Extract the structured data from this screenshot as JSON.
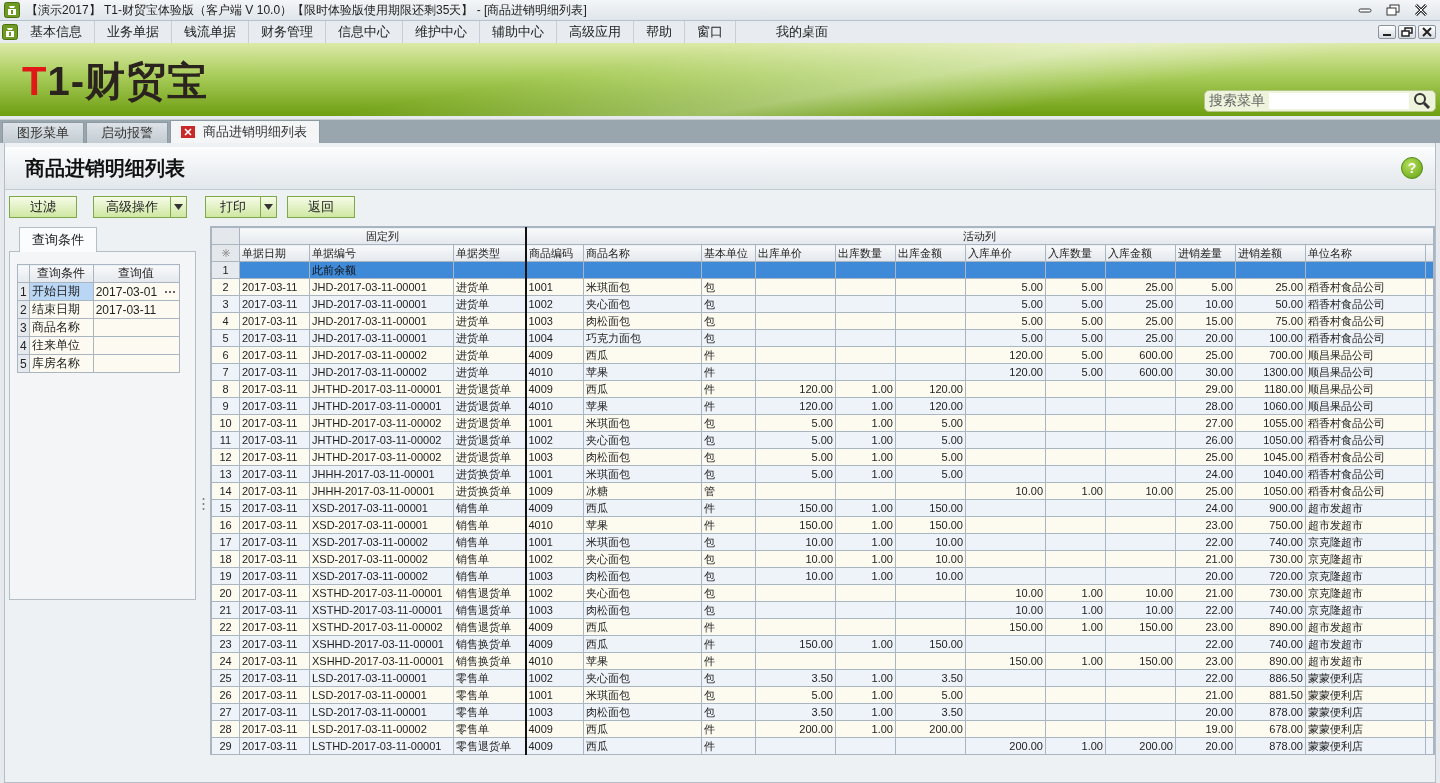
{
  "window": {
    "title": "【演示2017】 T1-财贸宝体验版（客户端 V 10.0）【限时体验版使用期限还剩35天】 - [商品进销明细列表]"
  },
  "menu": {
    "items": [
      "基本信息",
      "业务单据",
      "钱流单据",
      "财务管理",
      "信息中心",
      "维护中心",
      "辅助中心",
      "高级应用",
      "帮助",
      "窗口",
      "我的桌面"
    ]
  },
  "banner": {
    "logo": "T1-财贸宝",
    "search": {
      "label": "搜索菜单"
    }
  },
  "tabs": [
    {
      "label": "图形菜单",
      "selected": false,
      "closable": false
    },
    {
      "label": "启动报警",
      "selected": false,
      "closable": false
    },
    {
      "label": "商品进销明细列表",
      "selected": true,
      "closable": true
    }
  ],
  "page": {
    "title": "商品进销明细列表",
    "help": "?"
  },
  "toolbar": [
    {
      "label": "过滤",
      "kind": "plain"
    },
    {
      "label": "高级操作",
      "kind": "split"
    },
    {
      "label": "打印",
      "kind": "split"
    },
    {
      "label": "返回",
      "kind": "plain"
    }
  ],
  "query": {
    "tab": "查询条件",
    "columns": [
      "查询条件",
      "查询值"
    ],
    "rows": [
      {
        "no": "1",
        "name": "开始日期",
        "value": "2017-03-01",
        "selected": true
      },
      {
        "no": "2",
        "name": "结束日期",
        "value": "2017-03-11",
        "selected": false
      },
      {
        "no": "3",
        "name": "商品名称",
        "selected": false
      },
      {
        "no": "4",
        "name": "往来单位",
        "selected": false
      },
      {
        "no": "5",
        "name": "库房名称",
        "selected": false
      }
    ]
  },
  "table": {
    "groups": [
      "固定列",
      "活动列"
    ],
    "columns": [
      "单据日期",
      "单据编号",
      "单据类型",
      "商品编码",
      "商品名称",
      "基本单位",
      "出库单价",
      "出库数量",
      "出库金额",
      "入库单价",
      "入库数量",
      "入库金额",
      "进销差量",
      "进销差额",
      "单位名称"
    ],
    "rows": [
      {
        "no": "1",
        "selected": true,
        "cells": [
          "",
          "此前余额",
          "",
          "",
          "",
          "",
          "",
          "",
          "",
          "",
          "",
          "",
          "",
          "",
          ""
        ]
      },
      {
        "no": "2",
        "selected": false,
        "cells": [
          "2017-03-11",
          "JHD-2017-03-11-00001",
          "进货单",
          "1001",
          "米琪面包",
          "包",
          "",
          "",
          "",
          "5.00",
          "5.00",
          "25.00",
          "5.00",
          "25.00",
          "稻香村食品公司"
        ]
      },
      {
        "no": "3",
        "selected": false,
        "cells": [
          "2017-03-11",
          "JHD-2017-03-11-00001",
          "进货单",
          "1002",
          "夹心面包",
          "包",
          "",
          "",
          "",
          "5.00",
          "5.00",
          "25.00",
          "10.00",
          "50.00",
          "稻香村食品公司"
        ]
      },
      {
        "no": "4",
        "selected": false,
        "cells": [
          "2017-03-11",
          "JHD-2017-03-11-00001",
          "进货单",
          "1003",
          "肉松面包",
          "包",
          "",
          "",
          "",
          "5.00",
          "5.00",
          "25.00",
          "15.00",
          "75.00",
          "稻香村食品公司"
        ]
      },
      {
        "no": "5",
        "selected": false,
        "cells": [
          "2017-03-11",
          "JHD-2017-03-11-00001",
          "进货单",
          "1004",
          "巧克力面包",
          "包",
          "",
          "",
          "",
          "5.00",
          "5.00",
          "25.00",
          "20.00",
          "100.00",
          "稻香村食品公司"
        ]
      },
      {
        "no": "6",
        "selected": false,
        "cells": [
          "2017-03-11",
          "JHD-2017-03-11-00002",
          "进货单",
          "4009",
          "西瓜",
          "件",
          "",
          "",
          "",
          "120.00",
          "5.00",
          "600.00",
          "25.00",
          "700.00",
          "顺昌果品公司"
        ]
      },
      {
        "no": "7",
        "selected": false,
        "cells": [
          "2017-03-11",
          "JHD-2017-03-11-00002",
          "进货单",
          "4010",
          "苹果",
          "件",
          "",
          "",
          "",
          "120.00",
          "5.00",
          "600.00",
          "30.00",
          "1300.00",
          "顺昌果品公司"
        ]
      },
      {
        "no": "8",
        "selected": false,
        "cells": [
          "2017-03-11",
          "JHTHD-2017-03-11-00001",
          "进货退货单",
          "4009",
          "西瓜",
          "件",
          "120.00",
          "1.00",
          "120.00",
          "",
          "",
          "",
          "29.00",
          "1180.00",
          "顺昌果品公司"
        ]
      },
      {
        "no": "9",
        "selected": false,
        "cells": [
          "2017-03-11",
          "JHTHD-2017-03-11-00001",
          "进货退货单",
          "4010",
          "苹果",
          "件",
          "120.00",
          "1.00",
          "120.00",
          "",
          "",
          "",
          "28.00",
          "1060.00",
          "顺昌果品公司"
        ]
      },
      {
        "no": "10",
        "selected": false,
        "cells": [
          "2017-03-11",
          "JHTHD-2017-03-11-00002",
          "进货退货单",
          "1001",
          "米琪面包",
          "包",
          "5.00",
          "1.00",
          "5.00",
          "",
          "",
          "",
          "27.00",
          "1055.00",
          "稻香村食品公司"
        ]
      },
      {
        "no": "11",
        "selected": false,
        "cells": [
          "2017-03-11",
          "JHTHD-2017-03-11-00002",
          "进货退货单",
          "1002",
          "夹心面包",
          "包",
          "5.00",
          "1.00",
          "5.00",
          "",
          "",
          "",
          "26.00",
          "1050.00",
          "稻香村食品公司"
        ]
      },
      {
        "no": "12",
        "selected": false,
        "cells": [
          "2017-03-11",
          "JHTHD-2017-03-11-00002",
          "进货退货单",
          "1003",
          "肉松面包",
          "包",
          "5.00",
          "1.00",
          "5.00",
          "",
          "",
          "",
          "25.00",
          "1045.00",
          "稻香村食品公司"
        ]
      },
      {
        "no": "13",
        "selected": false,
        "cells": [
          "2017-03-11",
          "JHHH-2017-03-11-00001",
          "进货换货单",
          "1001",
          "米琪面包",
          "包",
          "5.00",
          "1.00",
          "5.00",
          "",
          "",
          "",
          "24.00",
          "1040.00",
          "稻香村食品公司"
        ]
      },
      {
        "no": "14",
        "selected": false,
        "cells": [
          "2017-03-11",
          "JHHH-2017-03-11-00001",
          "进货换货单",
          "1009",
          "冰糖",
          "管",
          "",
          "",
          "",
          "10.00",
          "1.00",
          "10.00",
          "25.00",
          "1050.00",
          "稻香村食品公司"
        ]
      },
      {
        "no": "15",
        "selected": false,
        "cells": [
          "2017-03-11",
          "XSD-2017-03-11-00001",
          "销售单",
          "4009",
          "西瓜",
          "件",
          "150.00",
          "1.00",
          "150.00",
          "",
          "",
          "",
          "24.00",
          "900.00",
          "超市发超市"
        ]
      },
      {
        "no": "16",
        "selected": false,
        "cells": [
          "2017-03-11",
          "XSD-2017-03-11-00001",
          "销售单",
          "4010",
          "苹果",
          "件",
          "150.00",
          "1.00",
          "150.00",
          "",
          "",
          "",
          "23.00",
          "750.00",
          "超市发超市"
        ]
      },
      {
        "no": "17",
        "selected": false,
        "cells": [
          "2017-03-11",
          "XSD-2017-03-11-00002",
          "销售单",
          "1001",
          "米琪面包",
          "包",
          "10.00",
          "1.00",
          "10.00",
          "",
          "",
          "",
          "22.00",
          "740.00",
          "京克隆超市"
        ]
      },
      {
        "no": "18",
        "selected": false,
        "cells": [
          "2017-03-11",
          "XSD-2017-03-11-00002",
          "销售单",
          "1002",
          "夹心面包",
          "包",
          "10.00",
          "1.00",
          "10.00",
          "",
          "",
          "",
          "21.00",
          "730.00",
          "京克隆超市"
        ]
      },
      {
        "no": "19",
        "selected": false,
        "cells": [
          "2017-03-11",
          "XSD-2017-03-11-00002",
          "销售单",
          "1003",
          "肉松面包",
          "包",
          "10.00",
          "1.00",
          "10.00",
          "",
          "",
          "",
          "20.00",
          "720.00",
          "京克隆超市"
        ]
      },
      {
        "no": "20",
        "selected": false,
        "cells": [
          "2017-03-11",
          "XSTHD-2017-03-11-00001",
          "销售退货单",
          "1002",
          "夹心面包",
          "包",
          "",
          "",
          "",
          "10.00",
          "1.00",
          "10.00",
          "21.00",
          "730.00",
          "京克隆超市"
        ]
      },
      {
        "no": "21",
        "selected": false,
        "cells": [
          "2017-03-11",
          "XSTHD-2017-03-11-00001",
          "销售退货单",
          "1003",
          "肉松面包",
          "包",
          "",
          "",
          "",
          "10.00",
          "1.00",
          "10.00",
          "22.00",
          "740.00",
          "京克隆超市"
        ]
      },
      {
        "no": "22",
        "selected": false,
        "cells": [
          "2017-03-11",
          "XSTHD-2017-03-11-00002",
          "销售退货单",
          "4009",
          "西瓜",
          "件",
          "",
          "",
          "",
          "150.00",
          "1.00",
          "150.00",
          "23.00",
          "890.00",
          "超市发超市"
        ]
      },
      {
        "no": "23",
        "selected": false,
        "cells": [
          "2017-03-11",
          "XSHHD-2017-03-11-00001",
          "销售换货单",
          "4009",
          "西瓜",
          "件",
          "150.00",
          "1.00",
          "150.00",
          "",
          "",
          "",
          "22.00",
          "740.00",
          "超市发超市"
        ]
      },
      {
        "no": "24",
        "selected": false,
        "cells": [
          "2017-03-11",
          "XSHHD-2017-03-11-00001",
          "销售换货单",
          "4010",
          "苹果",
          "件",
          "",
          "",
          "",
          "150.00",
          "1.00",
          "150.00",
          "23.00",
          "890.00",
          "超市发超市"
        ]
      },
      {
        "no": "25",
        "selected": false,
        "cells": [
          "2017-03-11",
          "LSD-2017-03-11-00001",
          "零售单",
          "1002",
          "夹心面包",
          "包",
          "3.50",
          "1.00",
          "3.50",
          "",
          "",
          "",
          "22.00",
          "886.50",
          "蒙蒙便利店"
        ]
      },
      {
        "no": "26",
        "selected": false,
        "cells": [
          "2017-03-11",
          "LSD-2017-03-11-00001",
          "零售单",
          "1001",
          "米琪面包",
          "包",
          "5.00",
          "1.00",
          "5.00",
          "",
          "",
          "",
          "21.00",
          "881.50",
          "蒙蒙便利店"
        ]
      },
      {
        "no": "27",
        "selected": false,
        "cells": [
          "2017-03-11",
          "LSD-2017-03-11-00001",
          "零售单",
          "1003",
          "肉松面包",
          "包",
          "3.50",
          "1.00",
          "3.50",
          "",
          "",
          "",
          "20.00",
          "878.00",
          "蒙蒙便利店"
        ]
      },
      {
        "no": "28",
        "selected": false,
        "cells": [
          "2017-03-11",
          "LSD-2017-03-11-00002",
          "零售单",
          "4009",
          "西瓜",
          "件",
          "200.00",
          "1.00",
          "200.00",
          "",
          "",
          "",
          "19.00",
          "678.00",
          "蒙蒙便利店"
        ]
      },
      {
        "no": "29",
        "selected": false,
        "cells": [
          "2017-03-11",
          "LSTHD-2017-03-11-00001",
          "零售退货单",
          "4009",
          "西瓜",
          "件",
          "",
          "",
          "",
          "200.00",
          "1.00",
          "200.00",
          "20.00",
          "878.00",
          "蒙蒙便利店"
        ]
      }
    ]
  }
}
